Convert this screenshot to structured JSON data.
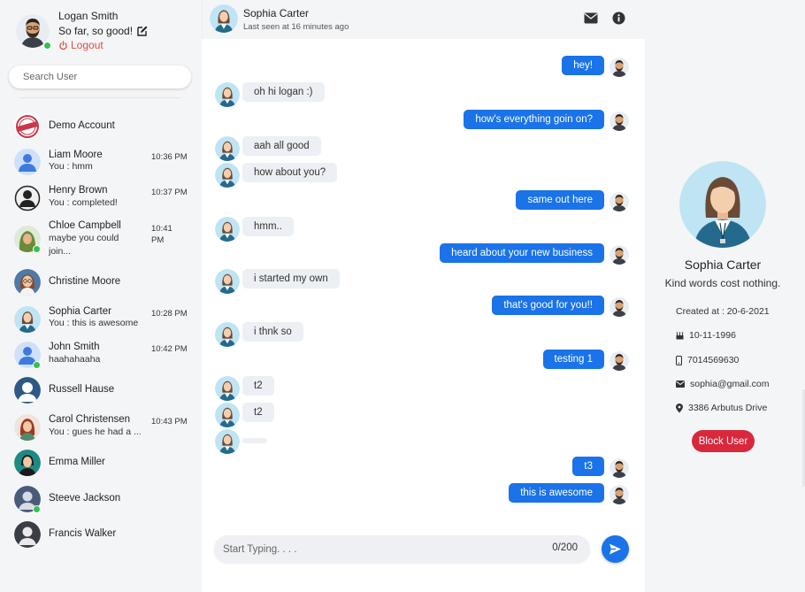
{
  "colors": {
    "primary": "#1a73e8",
    "danger": "#d9273b",
    "online": "#31c24d",
    "logout": "#e74c3c"
  },
  "me": {
    "name": "Logan Smith",
    "status": "So far, so good!",
    "logout_label": "Logout",
    "online": true
  },
  "search": {
    "placeholder": "Search User"
  },
  "contacts": [
    {
      "name": "Demo Account",
      "message": "",
      "time": "",
      "avatar": "sample-stamp",
      "online": false
    },
    {
      "name": "Liam Moore",
      "message": "You : hmm",
      "time": "10:36 PM",
      "avatar": "default-user",
      "online": false
    },
    {
      "name": "Henry Brown",
      "message": "You : completed!",
      "time": "10:37 PM",
      "avatar": "man-dark",
      "online": false
    },
    {
      "name": "Chloe Campbell",
      "message": "maybe you could join...",
      "time": "10:41 PM",
      "avatar": "woman-hijab",
      "online": true
    },
    {
      "name": "Christine Moore",
      "message": "",
      "time": "",
      "avatar": "woman-glasses",
      "online": false
    },
    {
      "name": "Sophia Carter",
      "message": "You : this is awesome",
      "time": "10:28 PM",
      "avatar": "woman-business",
      "online": false
    },
    {
      "name": "John Smith",
      "message": "haahahaaha",
      "time": "10:42 PM",
      "avatar": "default-user",
      "online": true
    },
    {
      "name": "Russell Hause",
      "message": "",
      "time": "",
      "avatar": "man-silhouette",
      "online": false
    },
    {
      "name": "Carol Christensen",
      "message": "You : gues he had a ...",
      "time": "10:43 PM",
      "avatar": "woman-red",
      "online": false
    },
    {
      "name": "Emma Miller",
      "message": "",
      "time": "",
      "avatar": "woman-teal",
      "online": false
    },
    {
      "name": "Steeve Jackson",
      "message": "",
      "time": "",
      "avatar": "man-slate",
      "online": true
    },
    {
      "name": "Francis Walker",
      "message": "",
      "time": "",
      "avatar": "man-silhouette-dark",
      "online": false
    }
  ],
  "chat": {
    "name": "Sophia Carter",
    "last_seen": "Last seen at 16 minutes ago",
    "messages": [
      {
        "from": "me",
        "text": "hey!"
      },
      {
        "from": "them",
        "text": "oh hi logan :)"
      },
      {
        "from": "me",
        "text": "how's everything goin on?"
      },
      {
        "from": "them",
        "text": "aah all good"
      },
      {
        "from": "them",
        "text": "how about you?"
      },
      {
        "from": "me",
        "text": "same out here"
      },
      {
        "from": "them",
        "text": "hmm.."
      },
      {
        "from": "me",
        "text": "heard about your new business"
      },
      {
        "from": "them",
        "text": "i started my own"
      },
      {
        "from": "me",
        "text": "that's good for you!!"
      },
      {
        "from": "them",
        "text": "i thnk so"
      },
      {
        "from": "me",
        "text": "testing 1"
      },
      {
        "from": "them",
        "text": "t2"
      },
      {
        "from": "them",
        "text": "t2"
      },
      {
        "from": "them",
        "text": ""
      },
      {
        "from": "me",
        "text": "t3"
      },
      {
        "from": "me",
        "text": "this is awesome"
      }
    ],
    "composer": {
      "placeholder": "Start Typing. . . .",
      "counter": "0/200"
    }
  },
  "details": {
    "name": "Sophia Carter",
    "bio": "Kind words cost nothing.",
    "created": "Created at : 20-6-2021",
    "birthday": "10-11-1996",
    "phone": "7014569630",
    "email": "sophia@gmail.com",
    "address": "3386 Arbutus Drive",
    "block_label": "Block User"
  }
}
